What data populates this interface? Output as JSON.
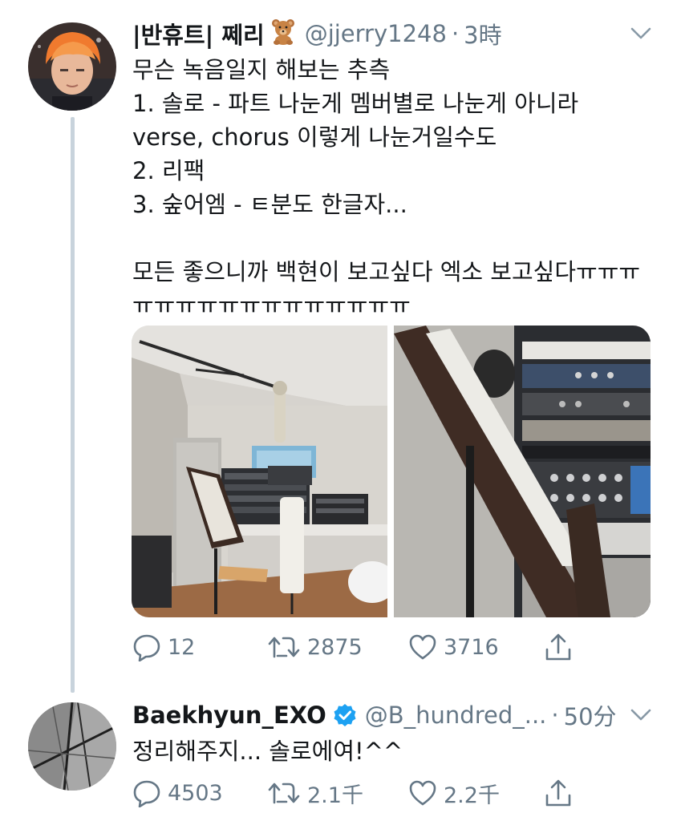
{
  "tweets": [
    {
      "display_name": "|반휴트| 쩨리",
      "handle": "@jjerry1248",
      "separator": "·",
      "time": "3時",
      "emoji": "teddy-bear",
      "lines": [
        "무슨 녹음일지 해보는 추측",
        "1. 솔로 - 파트 나눈게 멤버별로 나눈게 아니라",
        "verse, chorus 이렇게 나눈거일수도",
        "2. 리팩",
        "3. 숲어엠 - ㅌ분도 한글자...",
        "",
        "모든 좋으니까 백현이 보고싶다 엑소 보고싶다ㅠㅠㅠ",
        "ㅠㅠㅠㅠㅠㅠㅠㅠㅠㅠㅠㅠㅠ"
      ],
      "replies": "12",
      "retweets": "2875",
      "likes": "3716"
    },
    {
      "display_name": "Baekhyun_EXO",
      "handle": "@B_hundred_...",
      "separator": "·",
      "time": "50分",
      "verified": true,
      "lines": [
        "정리해주지... 솔로에여!^^"
      ],
      "replies": "4503",
      "retweets": "2.1千",
      "likes": "2.2千"
    }
  ],
  "colors": {
    "text": "#14171a",
    "secondary": "#657786",
    "verified": "#1da1f2",
    "thread_line": "#c8d3dc"
  },
  "icons": [
    "reply-icon",
    "retweet-icon",
    "like-icon",
    "share-icon",
    "caret-down-icon",
    "verified-badge-icon"
  ]
}
